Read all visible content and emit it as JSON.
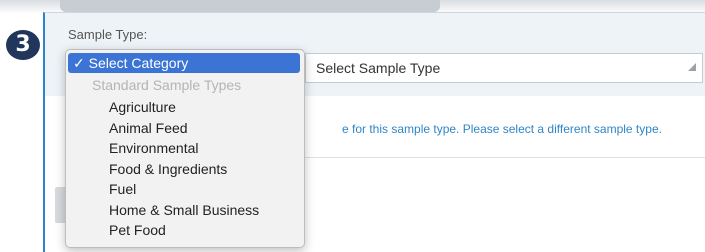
{
  "step": {
    "number": "3"
  },
  "form": {
    "label": "Sample Type:",
    "select_value": "Select Sample Type",
    "help_text": "e for this sample type. Please select a different sample type."
  },
  "dropdown": {
    "selected": "✓ Select Category",
    "group_label": "Standard Sample Types",
    "items": [
      "Agriculture",
      "Animal Feed",
      "Environmental",
      "Food & Ingredients",
      "Fuel",
      "Home & Small Business",
      "Pet Food"
    ]
  },
  "colors": {
    "badge": "#20365a",
    "accent": "#2e84c6",
    "selection": "#3b74d4"
  }
}
